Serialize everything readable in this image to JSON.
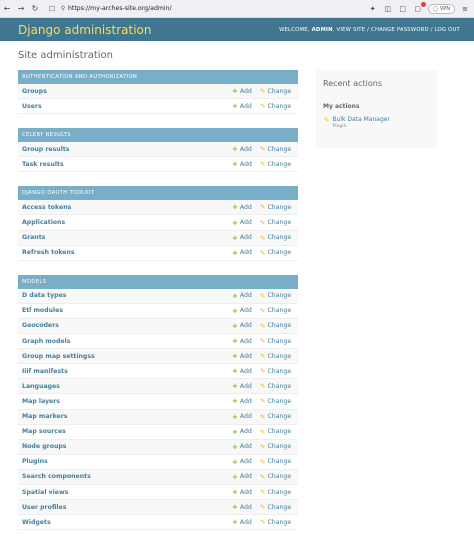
{
  "browser": {
    "url": "https://my-arches-site.org/admin/",
    "vpn_label": "VPN"
  },
  "header": {
    "site_name": "Django administration",
    "welcome": "WELCOME, ",
    "user": "ADMIN",
    "view_site": "VIEW SITE",
    "change_password": "CHANGE PASSWORD",
    "log_out": "LOG OUT",
    "separator": " / "
  },
  "page": {
    "title": "Site administration"
  },
  "labels": {
    "add": "Add",
    "change": "Change"
  },
  "modules": [
    {
      "caption": "AUTHENTICATION AND AUTHORIZATION",
      "models": [
        "Groups",
        "Users"
      ]
    },
    {
      "caption": "CELERY RESULTS",
      "models": [
        "Group results",
        "Task results"
      ]
    },
    {
      "caption": "DJANGO OAUTH TOOLKIT",
      "models": [
        "Access tokens",
        "Applications",
        "Grants",
        "Refresh tokens"
      ]
    },
    {
      "caption": "MODELS",
      "models": [
        "D data types",
        "Etl modules",
        "Geocoders",
        "Graph models",
        "Group map settingss",
        "Iiif manifests",
        "Languages",
        "Map layers",
        "Map markers",
        "Map sources",
        "Node groups",
        "Plugins",
        "Search components",
        "Spatial views",
        "User profiles",
        "Widgets"
      ]
    }
  ],
  "sidebar": {
    "title": "Recent actions",
    "subtitle": "My actions",
    "actions": [
      {
        "name": "Bulk Data Manager",
        "type": "Plugin"
      }
    ]
  },
  "colors": {
    "header_bg": "#417690",
    "site_name": "#f5dd5d",
    "caption_bg": "#79aec8",
    "link": "#447e9b",
    "add_icon": "#70bf2b",
    "change_icon": "#efb80b"
  }
}
